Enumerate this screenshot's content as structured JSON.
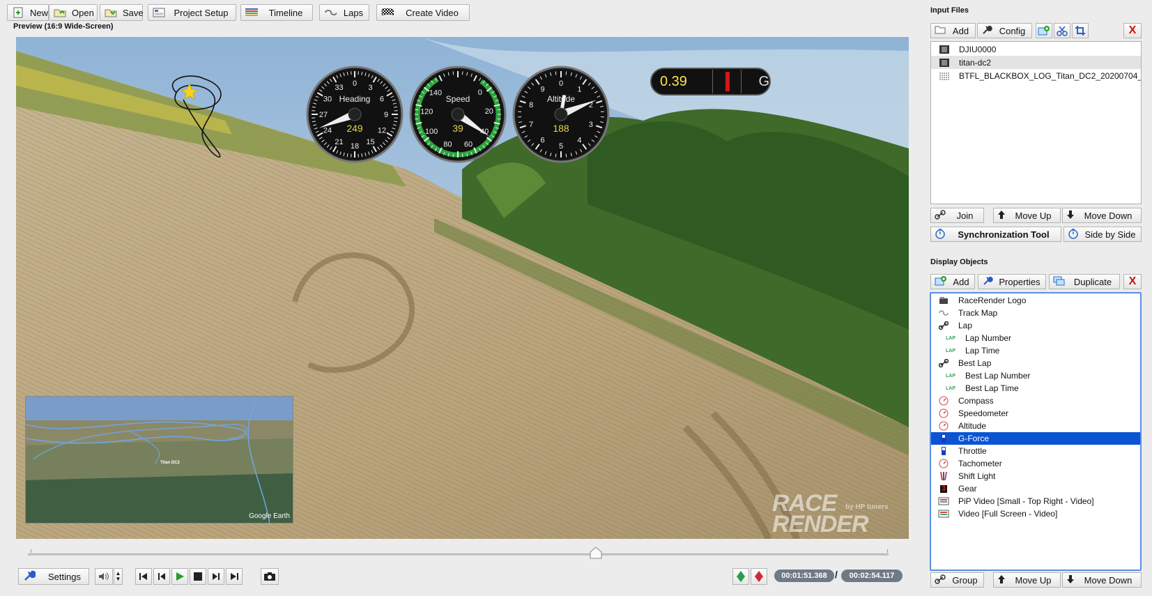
{
  "toolbar": {
    "new": "New",
    "open": "Open",
    "save": "Save",
    "project_setup": "Project Setup",
    "timeline": "Timeline",
    "laps": "Laps",
    "create_video": "Create Video"
  },
  "preview": {
    "title": "Preview (16:9 Wide-Screen)",
    "gauges": {
      "heading": {
        "label": "Heading",
        "value": "249",
        "ticks": [
          "0",
          "3",
          "6",
          "9",
          "12",
          "15",
          "18",
          "21",
          "24",
          "27",
          "30",
          "33"
        ]
      },
      "speed": {
        "label": "Speed",
        "value": "39",
        "ticks": [
          "0",
          "20",
          "40",
          "60",
          "80",
          "100",
          "120",
          "140"
        ]
      },
      "altitude": {
        "label": "Altitude",
        "value": "188",
        "ticks": [
          "0",
          "1",
          "2",
          "3",
          "4",
          "5",
          "6",
          "7",
          "8",
          "9"
        ]
      }
    },
    "gforce": {
      "value": "0.39",
      "unit": "G"
    },
    "pip": {
      "marker_label": "Titan DC2",
      "credit": "Google Earth"
    },
    "watermark": {
      "line1": "RACE",
      "line2": "RENDER",
      "byline": "by HP tuners"
    }
  },
  "timeline": {
    "position_fraction": 0.66,
    "settings_label": "Settings",
    "current_time": "00:01:51.368",
    "separator": "/",
    "total_time": "00:02:54.117"
  },
  "input_files": {
    "title": "Input Files",
    "add": "Add",
    "config": "Config",
    "items": [
      {
        "name": "DJIU0000",
        "icon": "video-file-icon"
      },
      {
        "name": "titan-dc2",
        "icon": "video-file-icon"
      },
      {
        "name": "BTFL_BLACKBOX_LOG_Titan_DC2_20200704_",
        "icon": "data-file-icon"
      }
    ],
    "join": "Join",
    "move_up": "Move Up",
    "move_down": "Move Down",
    "sync_tool": "Synchronization Tool",
    "side_by_side": "Side by Side"
  },
  "display_objects": {
    "title": "Display Objects",
    "add": "Add",
    "properties": "Properties",
    "duplicate": "Duplicate",
    "items": [
      {
        "name": "RaceRender Logo",
        "indent": 0,
        "icon": "logo-icon"
      },
      {
        "name": "Track Map",
        "indent": 0,
        "icon": "track-map-icon"
      },
      {
        "name": "Lap",
        "indent": 0,
        "icon": "link-icon"
      },
      {
        "name": "Lap Number",
        "indent": 1,
        "icon": "lap-icon"
      },
      {
        "name": "Lap Time",
        "indent": 1,
        "icon": "lap-icon"
      },
      {
        "name": "Best Lap",
        "indent": 0,
        "icon": "link-icon"
      },
      {
        "name": "Best Lap Number",
        "indent": 1,
        "icon": "lap-icon"
      },
      {
        "name": "Best Lap Time",
        "indent": 1,
        "icon": "lap-icon"
      },
      {
        "name": "Compass",
        "indent": 0,
        "icon": "dial-icon"
      },
      {
        "name": "Speedometer",
        "indent": 0,
        "icon": "dial-icon"
      },
      {
        "name": "Altitude",
        "indent": 0,
        "icon": "dial-icon"
      },
      {
        "name": "G-Force",
        "indent": 0,
        "icon": "bar-icon"
      },
      {
        "name": "Throttle",
        "indent": 0,
        "icon": "bar-icon"
      },
      {
        "name": "Tachometer",
        "indent": 0,
        "icon": "dial-icon"
      },
      {
        "name": "Shift Light",
        "indent": 0,
        "icon": "shift-light-icon"
      },
      {
        "name": "Gear",
        "indent": 0,
        "icon": "gear-number-icon"
      },
      {
        "name": "PiP Video [Small - Top Right - Video]",
        "indent": 0,
        "icon": "film-icon"
      },
      {
        "name": "Video [Full Screen - Video]",
        "indent": 0,
        "icon": "film-icon"
      }
    ],
    "selected": "G-Force",
    "group": "Group",
    "move_up": "Move Up",
    "move_down": "Move Down"
  },
  "colors": {
    "selection": "#0b54d4",
    "gauge_value": "#e8d64c",
    "gforce_value": "#ffe44a",
    "delete_red": "#d01010"
  }
}
